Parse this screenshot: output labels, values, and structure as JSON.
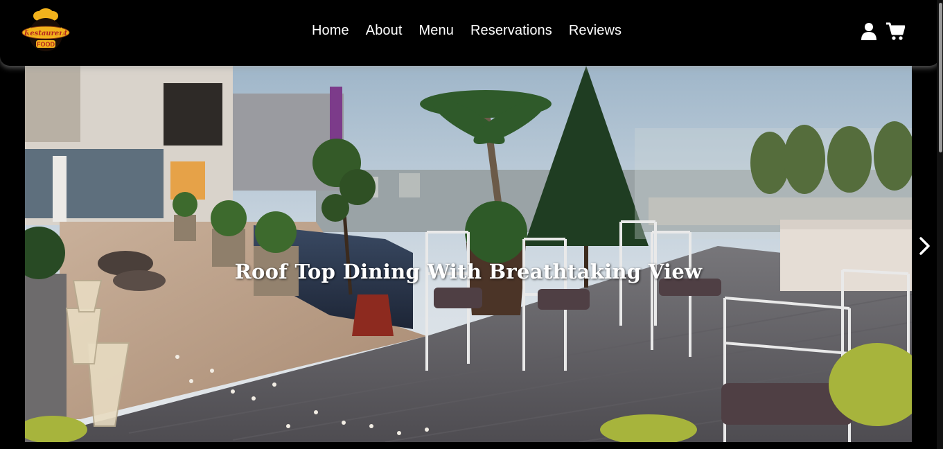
{
  "header": {
    "logo": {
      "line1": "Restaurent",
      "line2": "FOOD",
      "icon": "chef-hat-logo"
    },
    "nav": [
      {
        "label": "Home"
      },
      {
        "label": "About"
      },
      {
        "label": "Menu"
      },
      {
        "label": "Reservations"
      },
      {
        "label": "Reviews"
      }
    ],
    "icons": [
      "user-icon",
      "cart-icon"
    ]
  },
  "carousel": {
    "caption": "Roof Top Dining With Breathtaking View",
    "next_icon": "chevron-right-icon"
  },
  "colors": {
    "background": "#000000",
    "nav_text": "#ffffff",
    "logo_gold": "#f2b21c",
    "logo_red": "#b5261e"
  }
}
